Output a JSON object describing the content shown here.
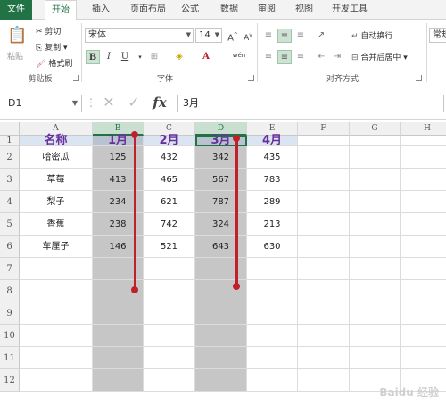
{
  "tabs": [
    "文件",
    "开始",
    "插入",
    "页面布局",
    "公式",
    "数据",
    "审阅",
    "视图",
    "开发工具"
  ],
  "ribbon": {
    "paste": "粘贴",
    "cut": "剪切",
    "copy": "复制",
    "format_painter": "格式刷",
    "clipboard_group": "剪贴板",
    "font_name": "宋体",
    "font_size": "14",
    "font_group": "字体",
    "bold": "B",
    "italic": "I",
    "underline": "U",
    "wen": "wén",
    "wrap_text": "自动换行",
    "merge_center": "合并后居中",
    "align_group": "对齐方式",
    "number_format": "常规"
  },
  "formula_bar": {
    "name_box": "D1",
    "fx": "fx",
    "content": "3月"
  },
  "columns": [
    "A",
    "B",
    "C",
    "D",
    "E",
    "F",
    "G",
    "H"
  ],
  "rows": [
    "1",
    "2",
    "3",
    "4",
    "5",
    "6",
    "7",
    "8",
    "9",
    "10",
    "11",
    "12"
  ],
  "table": {
    "headers": [
      "名称",
      "1月",
      "2月",
      "3月",
      "4月"
    ],
    "rows": [
      [
        "哈密瓜",
        "125",
        "432",
        "342",
        "435"
      ],
      [
        "草莓",
        "413",
        "465",
        "567",
        "783"
      ],
      [
        "梨子",
        "234",
        "621",
        "787",
        "289"
      ],
      [
        "香蕉",
        "238",
        "742",
        "324",
        "213"
      ],
      [
        "车厘子",
        "146",
        "521",
        "643",
        "630"
      ]
    ]
  },
  "colors": {
    "accent": "#217346",
    "header_fill": "#dbe5f1",
    "header_text": "#6a2f9e",
    "selection_grey": "#c6c6c6",
    "marker_red": "#c0202a"
  },
  "watermark": "Baidu 经验"
}
